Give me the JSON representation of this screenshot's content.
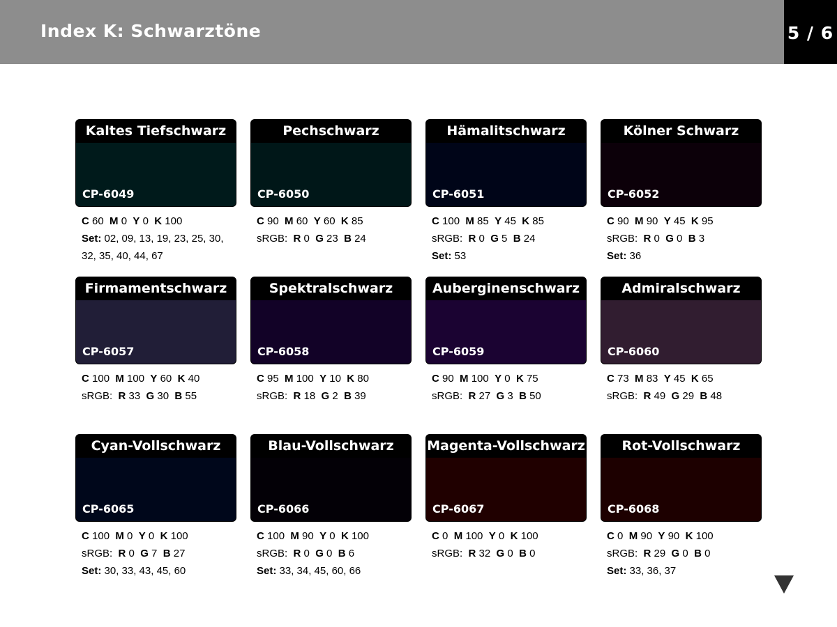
{
  "header": {
    "title": "Index K: Schwarztöne",
    "page": "5 / 6"
  },
  "cards": [
    {
      "name": "Kaltes Tiefschwarz",
      "code": "CP-6049",
      "color": "#001a1b",
      "cmyk": "<b>C</b> 60 &nbsp;<b>M</b> 0 &nbsp;<b>Y</b> 0 &nbsp;<b>K</b> 100",
      "rgb": "",
      "set": "02, 09, 13, 19, 23, 25, 30,",
      "set2": "32, 35, 40, 44, 67"
    },
    {
      "name": "Pechschwarz",
      "code": "CP-6050",
      "color": "#001718",
      "cmyk": "<b>C</b> 90 &nbsp;<b>M</b> 60 &nbsp;<b>Y</b> 60 &nbsp;<b>K</b> 85",
      "rgb": "sRGB: &nbsp;<b>R</b> 0 &nbsp;<b>G</b> 23 &nbsp;<b>B</b> 24",
      "set": "",
      "set2": ""
    },
    {
      "name": "Hämalitschwarz",
      "code": "CP-6051",
      "color": "#000518",
      "cmyk": "<b>C</b> 100 &nbsp;<b>M</b> 85 &nbsp;<b>Y</b> 45 &nbsp;<b>K</b> 85",
      "rgb": "sRGB: &nbsp;<b>R</b> 0 &nbsp;<b>G</b> 5 &nbsp;<b>B</b> 24",
      "set": "53",
      "set2": ""
    },
    {
      "name": "Kölner Schwarz",
      "code": "CP-6052",
      "color": "#0c0009",
      "cmyk": "<b>C</b> 90 &nbsp;<b>M</b> 90 &nbsp;<b>Y</b> 45 &nbsp;<b>K</b> 95",
      "rgb": "sRGB: &nbsp;<b>R</b> 0 &nbsp;<b>G</b> 0 &nbsp;<b>B</b> 3",
      "set": "36",
      "set2": ""
    },
    {
      "name": "Firmamentschwarz",
      "code": "CP-6057",
      "color": "#211e37",
      "cmyk": "<b>C</b> 100 &nbsp;<b>M</b> 100 &nbsp;<b>Y</b> 60 &nbsp;<b>K</b> 40",
      "rgb": "sRGB: &nbsp;<b>R</b> 33 &nbsp;<b>G</b> 30 &nbsp;<b>B</b> 55",
      "set": "",
      "set2": ""
    },
    {
      "name": "Spektralschwarz",
      "code": "CP-6058",
      "color": "#120227",
      "cmyk": "<b>C</b> 95 &nbsp;<b>M</b> 100 &nbsp;<b>Y</b> 10 &nbsp;<b>K</b> 80",
      "rgb": "sRGB: &nbsp;<b>R</b> 18 &nbsp;<b>G</b> 2 &nbsp;<b>B</b> 39",
      "set": "",
      "set2": ""
    },
    {
      "name": "Auberginenschwarz",
      "code": "CP-6059",
      "color": "#1b0332",
      "cmyk": "<b>C</b> 90 &nbsp;<b>M</b> 100 &nbsp;<b>Y</b> 0 &nbsp;<b>K</b> 75",
      "rgb": "sRGB: &nbsp;<b>R</b> 27 &nbsp;<b>G</b> 3 &nbsp;<b>B</b> 50",
      "set": "",
      "set2": ""
    },
    {
      "name": "Admiralschwarz",
      "code": "CP-6060",
      "color": "#311d30",
      "cmyk": "<b>C</b> 73 &nbsp;<b>M</b> 83 &nbsp;<b>Y</b> 45 &nbsp;<b>K</b> 65",
      "rgb": "sRGB: &nbsp;<b>R</b> 49 &nbsp;<b>G</b> 29 &nbsp;<b>B</b> 48",
      "set": "",
      "set2": ""
    },
    {
      "name": "Cyan-Vollschwarz",
      "code": "CP-6065",
      "color": "#00071b",
      "cmyk": "<b>C</b> 100 &nbsp;<b>M</b> 0 &nbsp;<b>Y</b> 0 &nbsp;<b>K</b> 100",
      "rgb": "sRGB: &nbsp;<b>R</b> 0 &nbsp;<b>G</b> 7 &nbsp;<b>B</b> 27",
      "set": "30, 33, 43, 45, 60",
      "set2": ""
    },
    {
      "name": "Blau-Vollschwarz",
      "code": "CP-6066",
      "color": "#030006",
      "cmyk": "<b>C</b> 100 &nbsp;<b>M</b> 90 &nbsp;<b>Y</b> 0 &nbsp;<b>K</b> 100",
      "rgb": "sRGB: &nbsp;<b>R</b> 0 &nbsp;<b>G</b> 0 &nbsp;<b>B</b> 6",
      "set": "33, 34, 45, 60, 66",
      "set2": ""
    },
    {
      "name": "Magenta-Vollschwarz",
      "code": "CP-6067",
      "color": "#200000",
      "cmyk": "<b>C</b> 0 &nbsp;<b>M</b> 100 &nbsp;<b>Y</b> 0 &nbsp;<b>K</b> 100",
      "rgb": "sRGB: &nbsp;<b>R</b> 32 &nbsp;<b>G</b> 0 &nbsp;<b>B</b> 0",
      "set": "",
      "set2": ""
    },
    {
      "name": "Rot-Vollschwarz",
      "code": "CP-6068",
      "color": "#1d0000",
      "cmyk": "<b>C</b> 0 &nbsp;<b>M</b> 90 &nbsp;<b>Y</b> 90 &nbsp;<b>K</b> 100",
      "rgb": "sRGB: &nbsp;<b>R</b> 29 &nbsp;<b>G</b> 0 &nbsp;<b>B</b> 0",
      "set": "33, 36, 37",
      "set2": ""
    }
  ],
  "labels": {
    "set_label": "Set:"
  }
}
